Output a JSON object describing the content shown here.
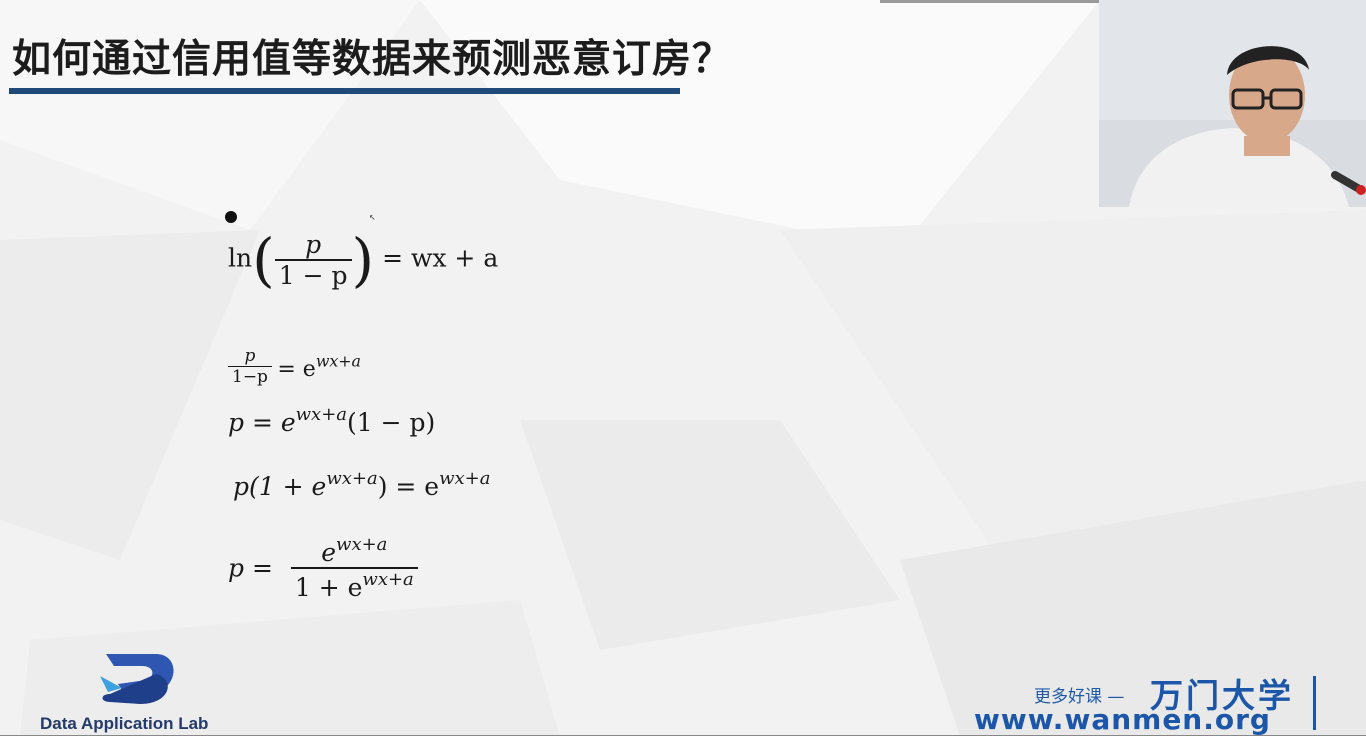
{
  "slide": {
    "title": "如何通过信用值等数据来预测恶意订房？"
  },
  "equations": {
    "eq1": {
      "ln": "ln",
      "num": "p",
      "den": "1 − p",
      "rhs": "= wx + a"
    },
    "eq2": {
      "num": "p",
      "den": "1−p",
      "rhs": "= e",
      "exp": "wx+a"
    },
    "eq3": {
      "lhs": "p = e",
      "exp": "wx+a",
      "tail": "(1 − p)"
    },
    "eq4": {
      "lhs": "p(1 + e",
      "exp1": "wx+a",
      "mid": ") = e",
      "exp2": "wx+a"
    },
    "eq5": {
      "lhs": "p =",
      "num": "e",
      "num_exp": "wx+a",
      "den": "1 + e",
      "den_exp": "wx+a"
    }
  },
  "branding": {
    "logo_text": "Data Application Lab",
    "promo": "更多好课 —",
    "brand_name": "万门大学",
    "url": "www.wanmen.org"
  },
  "colors": {
    "title_rule": "#1f4a7a",
    "brand_blue": "#1c56a8"
  }
}
